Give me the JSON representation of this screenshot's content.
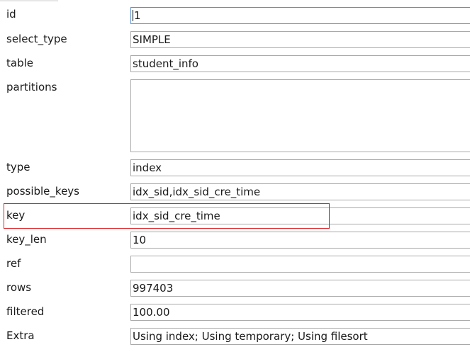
{
  "rows": [
    {
      "label": "id",
      "value": "1"
    },
    {
      "label": "select_type",
      "value": "SIMPLE"
    },
    {
      "label": "table",
      "value": "student_info"
    },
    {
      "label": "partitions",
      "value": ""
    },
    {
      "label": "type",
      "value": "index"
    },
    {
      "label": "possible_keys",
      "value": "idx_sid,idx_sid_cre_time"
    },
    {
      "label": "key",
      "value": "idx_sid_cre_time"
    },
    {
      "label": "key_len",
      "value": "10"
    },
    {
      "label": "ref",
      "value": ""
    },
    {
      "label": "rows",
      "value": "997403"
    },
    {
      "label": "filtered",
      "value": "100.00"
    },
    {
      "label": "Extra",
      "value": "Using index; Using temporary; Using filesort"
    }
  ],
  "highlight_color": "#d9262c",
  "focus_color": "#5b8fd6"
}
